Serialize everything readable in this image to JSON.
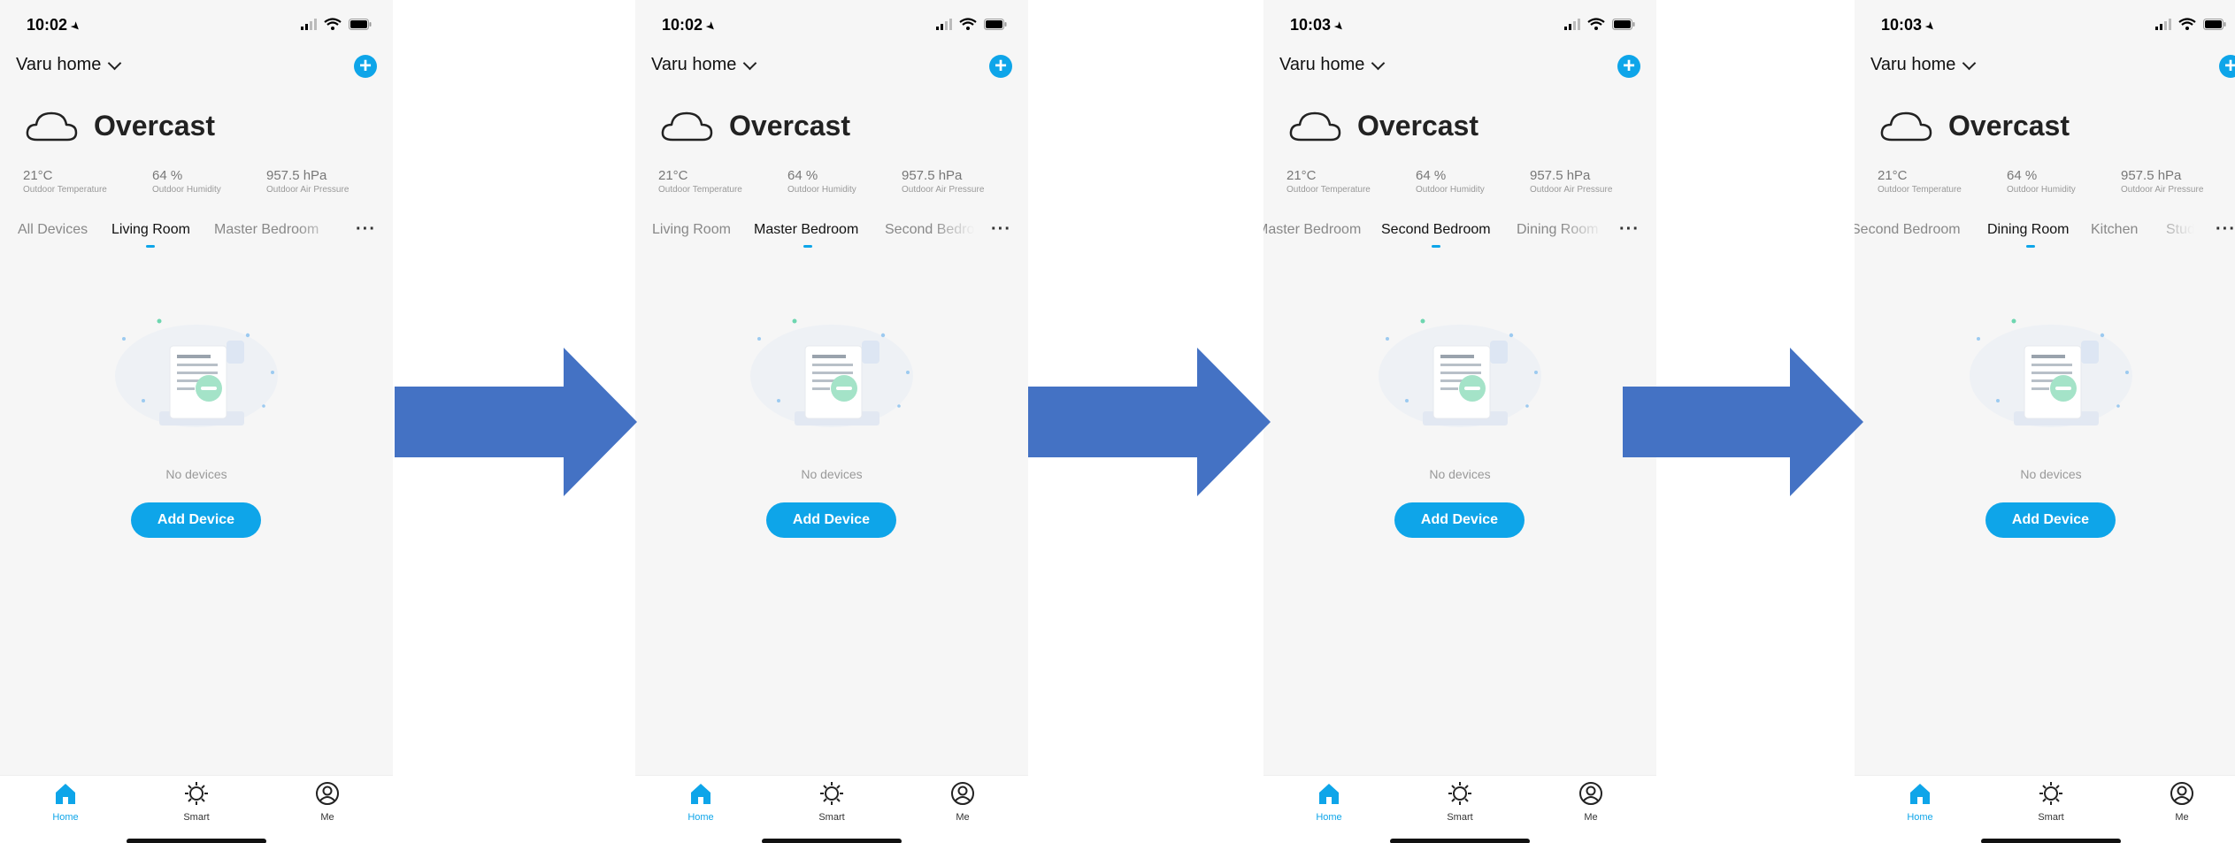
{
  "screens": [
    {
      "time": "10:02",
      "home_name": "Varu home",
      "weather_condition": "Overcast",
      "stats": [
        {
          "value": "21°C",
          "label": "Outdoor Temperature"
        },
        {
          "value": "64 %",
          "label": "Outdoor Humidity"
        },
        {
          "value": "957.5 hPa",
          "label": "Outdoor Air Pressure"
        }
      ],
      "tabs": [
        "All Devices",
        "Living Room",
        "Master Bedroom"
      ],
      "active_tab": "Living Room",
      "empty_text": "No devices",
      "add_device_label": "Add Device"
    },
    {
      "time": "10:02",
      "home_name": "Varu home",
      "weather_condition": "Overcast",
      "stats": [
        {
          "value": "21°C",
          "label": "Outdoor Temperature"
        },
        {
          "value": "64 %",
          "label": "Outdoor Humidity"
        },
        {
          "value": "957.5 hPa",
          "label": "Outdoor Air Pressure"
        }
      ],
      "tabs": [
        "Living Room",
        "Master Bedroom",
        "Second Bedroom"
      ],
      "active_tab": "Master Bedroom",
      "empty_text": "No devices",
      "add_device_label": "Add Device"
    },
    {
      "time": "10:03",
      "home_name": "Varu home",
      "weather_condition": "Overcast",
      "stats": [
        {
          "value": "21°C",
          "label": "Outdoor Temperature"
        },
        {
          "value": "64 %",
          "label": "Outdoor Humidity"
        },
        {
          "value": "957.5 hPa",
          "label": "Outdoor Air Pressure"
        }
      ],
      "tabs": [
        "Master Bedroom",
        "Second Bedroom",
        "Dining Room"
      ],
      "active_tab": "Second Bedroom",
      "empty_text": "No devices",
      "add_device_label": "Add Device"
    },
    {
      "time": "10:03",
      "home_name": "Varu home",
      "weather_condition": "Overcast",
      "stats": [
        {
          "value": "21°C",
          "label": "Outdoor Temperature"
        },
        {
          "value": "64 %",
          "label": "Outdoor Humidity"
        },
        {
          "value": "957.5 hPa",
          "label": "Outdoor Air Pressure"
        }
      ],
      "tabs": [
        "Second Bedroom",
        "Dining Room",
        "Kitchen",
        "Study"
      ],
      "active_tab": "Dining Room",
      "empty_text": "No devices",
      "add_device_label": "Add Device"
    }
  ],
  "bottom_nav": [
    {
      "label": "Home",
      "icon": "home-icon"
    },
    {
      "label": "Smart",
      "icon": "sun-icon"
    },
    {
      "label": "Me",
      "icon": "user-icon"
    }
  ],
  "colors": {
    "accent": "#0ea5e9",
    "arrow": "#4472c4",
    "background": "#f6f6f6"
  }
}
